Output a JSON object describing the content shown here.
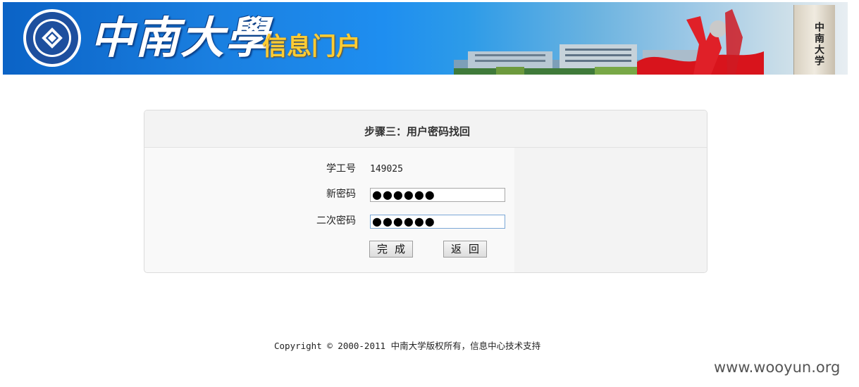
{
  "banner": {
    "university_name": "中南大學",
    "portal_name": "信息门户",
    "tower_text": "中南大学"
  },
  "panel": {
    "title": "步骤三：用户密码找回",
    "fields": {
      "student_id_label": "学工号",
      "student_id_value": "149025",
      "new_password_label": "新密码",
      "new_password_value": "●●●●●●",
      "confirm_password_label": "二次密码",
      "confirm_password_value": "●●●●●●"
    },
    "buttons": {
      "finish_label": "完成",
      "back_label": "返回"
    }
  },
  "footer": {
    "copyright": "Copyright © 2000-2011 中南大学版权所有，信息中心技术支持"
  },
  "watermark": "www.wooyun.org"
}
